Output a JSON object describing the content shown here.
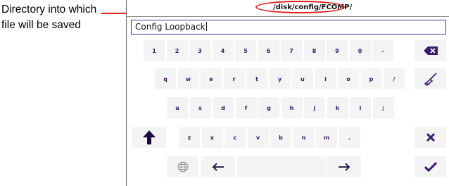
{
  "callout": {
    "text_line1": "Directory into which",
    "text_line2": "file will be saved",
    "accent": "#e01b1b"
  },
  "path": "/disk/config/FCOMP/",
  "input": {
    "value": "Config Loopback"
  },
  "keyboard": {
    "number_row": [
      "1",
      "2",
      "3",
      "4",
      "5",
      "6",
      "7",
      "8",
      "9",
      "0",
      "-"
    ],
    "row_q": [
      "q",
      "w",
      "e",
      "r",
      "t",
      "y",
      "u",
      "i",
      "o",
      "p",
      "/"
    ],
    "row_a": [
      "a",
      "s",
      "d",
      "f",
      "g",
      "h",
      "j",
      "k",
      "l",
      ";"
    ],
    "row_z": [
      "z",
      "x",
      "c",
      "v",
      "b",
      "n",
      "m",
      "."
    ],
    "key_color": "#3d1a6e",
    "key_bg": "#f4f4f4",
    "icons": {
      "backspace": "backspace-icon",
      "clear": "broom-icon",
      "shift": "shift-up-arrow-icon",
      "cancel": "close-icon",
      "confirm": "checkmark-icon",
      "language": "globe-icon",
      "left": "arrow-left-icon",
      "right": "arrow-right-icon"
    }
  }
}
